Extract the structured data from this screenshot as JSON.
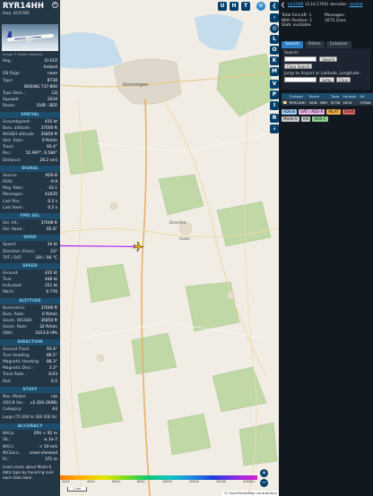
{
  "info": {
    "callsign": "RYR14HH",
    "hex": "Hex: 4CA785",
    "close_glyph": "✕",
    "photo_credit": "Image © Radim Koblizka",
    "registration": [
      {
        "k": "Reg.:",
        "v": "EI-EFZ"
      },
      {
        "k": "",
        "v": "Ireland"
      },
      {
        "k": "DB flags:",
        "v": "none"
      },
      {
        "k": "Type:",
        "v": "B738"
      },
      {
        "k": "",
        "v": "BOEING 737-800"
      },
      {
        "k": "Type Desc.:",
        "v": "L2J"
      },
      {
        "k": "Squawk:",
        "v": "2034"
      },
      {
        "k": "Route:",
        "v": "DUB - BER"
      }
    ],
    "spatial_title": "SPATIAL",
    "spatial": [
      {
        "k": "Groundspeed:",
        "v": "435 kt"
      },
      {
        "k": "Baro. altitude:",
        "v": "37000 ft"
      },
      {
        "k": "WGS84 altitude:",
        "v": "35850 ft"
      },
      {
        "k": "Vert. Rate:",
        "v": "0 ft/min"
      },
      {
        "k": "Track:",
        "v": "93.4°"
      },
      {
        "k": "Pos.:",
        "v": "52.997°, 6.584°"
      },
      {
        "k": "Distance:",
        "v": "26.2 nmi"
      }
    ],
    "signal_title": "SIGNAL",
    "signal": [
      {
        "k": "Source:",
        "v": "ADS-B"
      },
      {
        "k": "RSSI:",
        "v": "-9.9"
      },
      {
        "k": "Msg. Rate:",
        "v": "43.1"
      },
      {
        "k": "Messages:",
        "v": "43435"
      },
      {
        "k": "Last Pos.:",
        "v": "0.2 s"
      },
      {
        "k": "Last Seen:",
        "v": "0.2 s"
      }
    ],
    "fms_title": "FMS SEL",
    "fms": [
      {
        "k": "Sel. Alt.:",
        "v": "37008 ft"
      },
      {
        "k": "Sel. Head.:",
        "v": "85.8°"
      }
    ],
    "wind_title": "WIND",
    "wind": [
      {
        "k": "Speed:",
        "v": "34 kt"
      },
      {
        "k": "Direction (from):",
        "v": "23°"
      },
      {
        "k": "TAT / OAT:",
        "v": "-29 / -56 °C"
      }
    ],
    "speed_title": "SPEED",
    "speed": [
      {
        "k": "Ground:",
        "v": "435 kt"
      },
      {
        "k": "True:",
        "v": "448 kt"
      },
      {
        "k": "Indicated:",
        "v": "251 kt"
      },
      {
        "k": "Mach:",
        "v": "0.776"
      }
    ],
    "altitude_title": "ALTITUDE",
    "altitude": [
      {
        "k": "Barometric:",
        "v": "37000 ft"
      },
      {
        "k": "Baro. Rate:",
        "v": "0 ft/min"
      },
      {
        "k": "Geom. WGS84:",
        "v": "35850 ft"
      },
      {
        "k": "Geom. Rate:",
        "v": "32 ft/min"
      },
      {
        "k": "QNH:",
        "v": "1013.6 hPa"
      }
    ],
    "direction_title": "DIRECTION",
    "direction": [
      {
        "k": "Ground Track:",
        "v": "93.4°"
      },
      {
        "k": "True Heading:",
        "v": "89.2°"
      },
      {
        "k": "Magnetic Heading:",
        "v": "86.3°"
      },
      {
        "k": "Magnetic Decl.:",
        "v": "3.3°"
      },
      {
        "k": "Track Rate:",
        "v": "0.03"
      },
      {
        "k": "Roll:",
        "v": "0.5"
      }
    ],
    "stuff_title": "STUFF",
    "stuff": [
      {
        "k": "Nav. Modes:",
        "v": "n/a"
      },
      {
        "k": "ADS-B Ver.:",
        "v": "v2 (DO-260B)"
      },
      {
        "k": "Category:",
        "v": "A3"
      }
    ],
    "category_desc": "Large (75 000 to 300 000 lb)",
    "accuracy_title": "ACCURACY",
    "accuracy": [
      {
        "k": "NACp:",
        "v": "EPU < 92 m"
      },
      {
        "k": "SIL:",
        "v": "≤ 1e-7"
      },
      {
        "k": "NACv:",
        "v": "< 10 m/s"
      },
      {
        "k": "NICbaro:",
        "v": "cross-checked"
      },
      {
        "k": "Rc:",
        "v": "371 m"
      }
    ],
    "footer_note": "Learn more about Mode-S data type by hovering over each data label."
  },
  "map": {
    "buttons_top": [
      "U",
      "H",
      "T"
    ],
    "side_buttons": [
      "L",
      "O",
      "K",
      "M",
      "V",
      "P",
      "I",
      "R"
    ],
    "places": [
      "Groningen",
      "Drenthe",
      "Assen"
    ],
    "zoom_in": "+",
    "zoom_out": "−",
    "scale_label": "2 km",
    "attribution": "© OpenStreetMap contributors",
    "alt_ticks": [
      "2000",
      "4000",
      "6000",
      "8000",
      "10000",
      "20000",
      "30000",
      "40000+"
    ],
    "aircraft_track_deg": 93.4
  },
  "sidebar": {
    "collapse_arrow": "❮",
    "version_link": "tar1090",
    "version": "(3.14.1792)",
    "decoder_label": "decoder:",
    "decoder_value": "readsb",
    "total_aircraft_label": "Total Aircraft:",
    "total_aircraft": "1",
    "with_position_label": "With Position:",
    "with_position": "1",
    "stats_available": "Stats available",
    "messages_label": "Messages:",
    "messages_rate": "1675.2/sec",
    "tabs": [
      "Search",
      "Filters",
      "Columns"
    ],
    "search_label": "Search:",
    "search_button": "Search",
    "clear_search": "Clear Search",
    "jump_label": "Jump to Airport or Latitude, Longitude:",
    "jump_button": "Jump",
    "clear_button": "Clear",
    "table_headers": [
      "",
      "Callsign",
      "Route",
      "Type",
      "Squawk",
      "Alt"
    ],
    "rows": [
      {
        "flag": "",
        "callsign": "RYR14HH",
        "route": "DUB - BER",
        "type": "B738",
        "squawk": "2034",
        "alt": "37000"
      }
    ],
    "legend": [
      {
        "label": "ADS-B",
        "color": "#9ec9f0"
      },
      {
        "label": "UAT / ADS-R",
        "color": "#e9b6e5"
      },
      {
        "label": "MLAT",
        "color": "#f0b04a"
      },
      {
        "label": "TIS-B",
        "color": "#e06060"
      },
      {
        "label": "Mode-S",
        "color": "#c8c8c8"
      },
      {
        "label": "AIS",
        "color": "#c8c8c8"
      },
      {
        "label": "ADS-C",
        "color": "#8fd18f"
      }
    ]
  }
}
